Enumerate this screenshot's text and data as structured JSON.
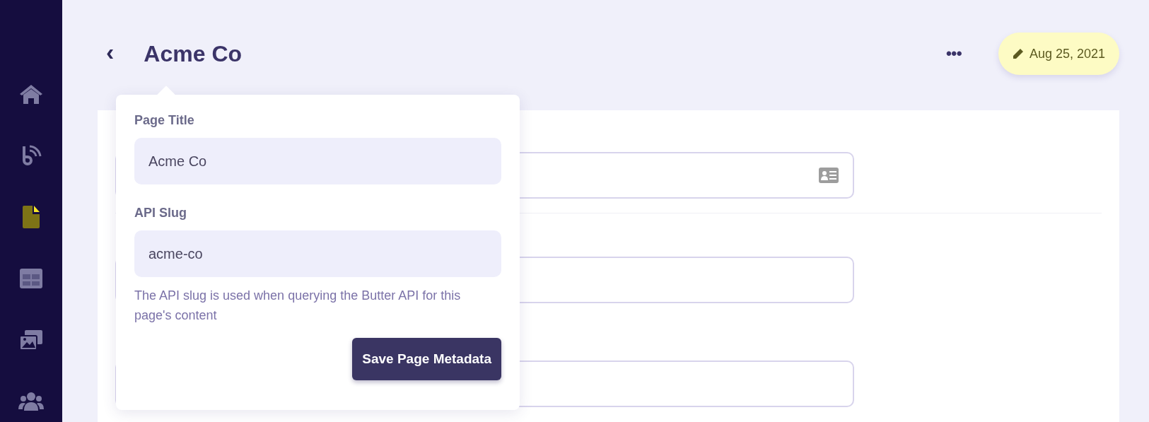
{
  "sidebar": {
    "items": [
      {
        "kind": "home",
        "selected": false
      },
      {
        "kind": "blog",
        "selected": false
      },
      {
        "kind": "page",
        "selected": true
      },
      {
        "kind": "collection",
        "selected": false
      },
      {
        "kind": "media",
        "selected": false
      },
      {
        "kind": "users",
        "selected": false
      }
    ]
  },
  "header": {
    "back": "‹",
    "title": "Acme Co",
    "more": "•••",
    "date": "Aug 25, 2021"
  },
  "background_fields": [
    {
      "kind": "contact"
    },
    {
      "kind": "plain"
    },
    {
      "kind": "plain"
    }
  ],
  "popover": {
    "fields": [
      {
        "label": "Page Title",
        "value": "Acme Co"
      },
      {
        "label": "API Slug",
        "value": "acme-co"
      }
    ],
    "help": "The API slug is used when querying the Butter API for this page's content",
    "button": "Save Page Metadata"
  }
}
